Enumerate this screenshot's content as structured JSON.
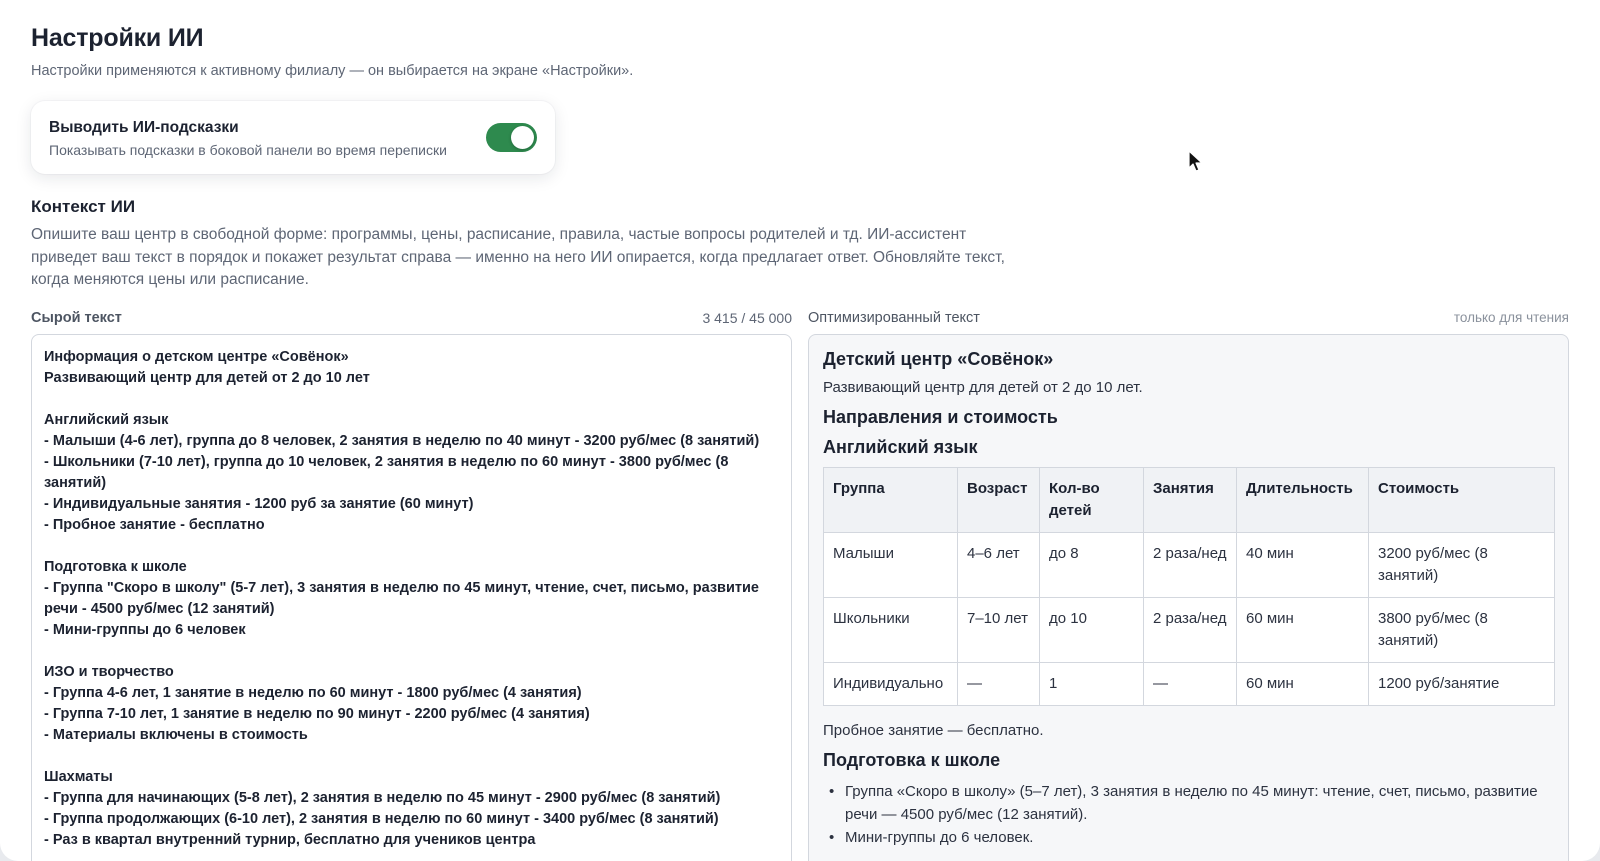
{
  "header": {
    "title": "Настройки ИИ",
    "subtitle": "Настройки применяются к активному филиалу — он выбирается на экране «Настройки»."
  },
  "hints_toggle": {
    "title": "Выводить ИИ-подсказки",
    "description": "Показывать подсказки в боковой панели во время переписки",
    "enabled": true,
    "on_color": "#2e8a4e"
  },
  "context": {
    "title": "Контекст ИИ",
    "description": "Опишите ваш центр в свободной форме: программы, цены, расписание, правила, частые вопросы родителей и тд. ИИ-ассистент приведет ваш текст в порядок и покажет результат справа — именно на него ИИ опирается, когда предлагает ответ. Обновляйте текст, когда меняются цены или расписание."
  },
  "raw": {
    "label": "Сырой текст",
    "counter": "3 415 / 45 000",
    "lines": [
      "Информация о детском центре «Совёнок»",
      "Развивающий центр для детей от 2 до 10 лет",
      "",
      "Английский язык",
      "- Малыши (4-6 лет), группа до 8 человек, 2 занятия в неделю по 40 минут - 3200 руб/мес (8 занятий)",
      "- Школьники (7-10 лет), группа до 10 человек, 2 занятия в неделю по 60 минут - 3800 руб/мес (8 занятий)",
      "- Индивидуальные занятия - 1200 руб за занятие (60 минут)",
      "- Пробное занятие - бесплатно",
      "",
      "Подготовка к школе",
      "- Группа \"Скоро в школу\" (5-7 лет), 3 занятия в неделю по 45 минут, чтение, счет, письмо, развитие речи - 4500 руб/мес (12 занятий)",
      "- Мини-группы до 6 человек",
      "",
      "ИЗО и творчество",
      "- Группа 4-6 лет, 1 занятие в неделю по 60 минут - 1800 руб/мес (4 занятия)",
      "- Группа 7-10 лет, 1 занятие в неделю по 90 минут - 2200 руб/мес (4 занятия)",
      "- Материалы включены в стоимость",
      "",
      "Шахматы",
      "- Группа для начинающих (5-8 лет), 2 занятия в неделю по 45 минут - 2900 руб/мес (8 занятий)",
      "- Группа продолжающих (6-10 лет), 2 занятия в неделю по 60 минут - 3400 руб/мес (8 занятий)",
      "- Раз в квартал внутренний турнир, бесплатно для учеников центра"
    ]
  },
  "optimized": {
    "label": "Оптимизированный текст",
    "readonly_note": "только для чтения",
    "title": "Детский центр «Совёнок»",
    "intro": "Развивающий центр для детей от 2 до 10 лет.",
    "section_heading": "Направления и стоимость",
    "english_heading": "Английский язык",
    "table_headers": [
      "Группа",
      "Возраст",
      "Кол-во детей",
      "Занятия",
      "Длительность",
      "Стоимость"
    ],
    "table_rows": [
      [
        "Малыши",
        "4–6 лет",
        "до 8",
        "2 раза/нед",
        "40 мин",
        "3200 руб/мес (8 занятий)"
      ],
      [
        "Школьники",
        "7–10 лет",
        "до 10",
        "2 раза/нед",
        "60 мин",
        "3800 руб/мес (8 занятий)"
      ],
      [
        "Индивидуально",
        "—",
        "1",
        "—",
        "60 мин",
        "1200 руб/занятие"
      ]
    ],
    "trial_note": "Пробное занятие — бесплатно.",
    "school_heading": "Подготовка к школе",
    "school_items": [
      "Группа «Скоро в школу» (5–7 лет), 3 занятия в неделю по 45 минут: чтение, счет, письмо, развитие речи — 4500 руб/мес (12 занятий).",
      "Мини-группы до 6 человек."
    ]
  }
}
